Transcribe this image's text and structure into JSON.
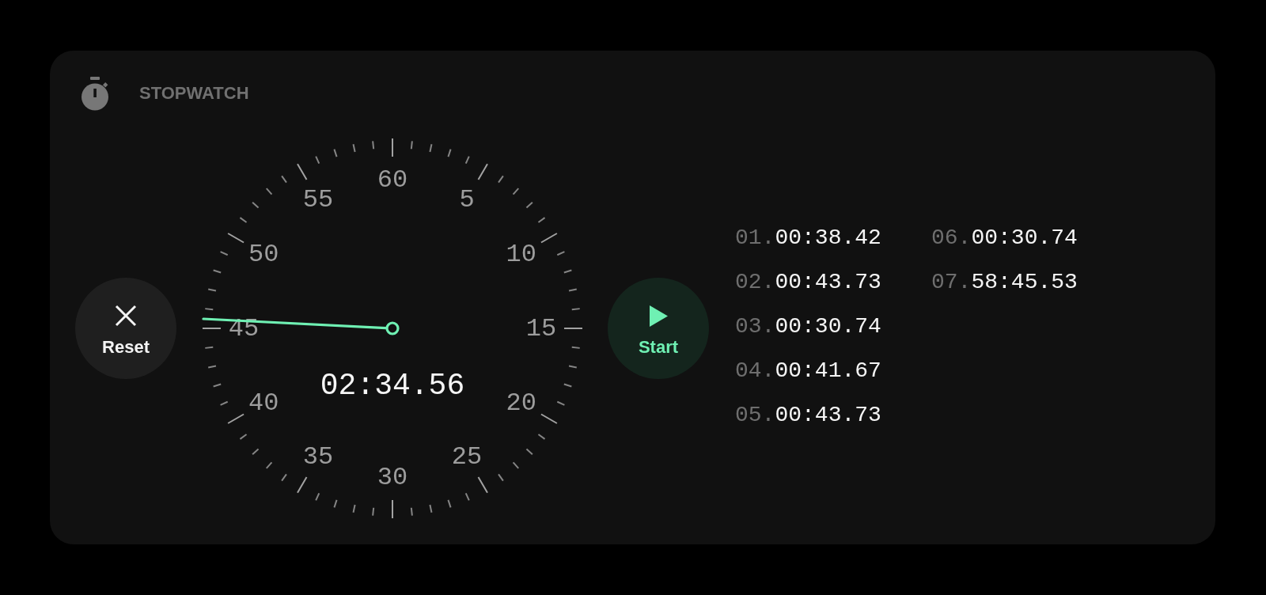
{
  "header": {
    "title": "STOPWATCH"
  },
  "reset_button": {
    "label": "Reset"
  },
  "dial": {
    "numbers": [
      "60",
      "5",
      "10",
      "15",
      "20",
      "25",
      "30",
      "35",
      "40",
      "45",
      "50",
      "55"
    ],
    "elapsed": "02:34.56"
  },
  "start_button": {
    "label": "Start"
  },
  "laps": [
    {
      "number": "01.",
      "time": "00:38.42"
    },
    {
      "number": "02.",
      "time": "00:43.73"
    },
    {
      "number": "03.",
      "time": "00:30.74"
    },
    {
      "number": "04.",
      "time": "00:41.67"
    },
    {
      "number": "05.",
      "time": "00:43.73"
    },
    {
      "number": "06.",
      "time": "00:30.74"
    },
    {
      "number": "07.",
      "time": "58:45.53"
    }
  ]
}
